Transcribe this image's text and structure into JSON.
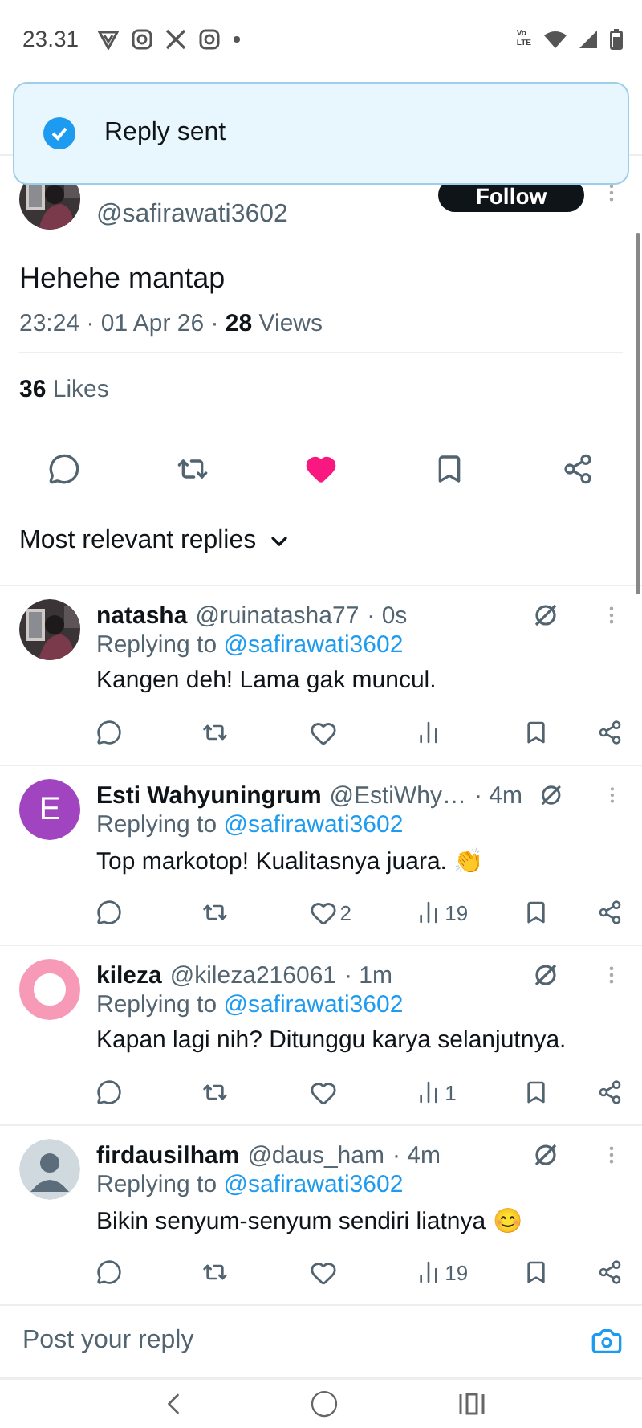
{
  "status_bar": {
    "time": "23.31",
    "network_label": [
      "Vo",
      "LTE"
    ]
  },
  "toast": {
    "message": "Reply sent"
  },
  "post": {
    "author_handle": "@safirawati3602",
    "follow_label": "Follow",
    "text": "Hehehe mantap",
    "time": "23:24 · 01 Apr 26 · ",
    "views_count": "28",
    "views_label": " Views",
    "likes_count": "36",
    "likes_label": " Likes",
    "liked": true,
    "bookmarked": false
  },
  "replies_sort": {
    "label": "Most relevant replies"
  },
  "replies": [
    {
      "name": "natasha",
      "handle": "@ruinatasha77",
      "time": "· 0s",
      "replying_label": "Replying to ",
      "replying_to": "@safirawati3602",
      "text": "Kangen deh! Lama gak muncul.",
      "liked": false
    },
    {
      "name": "Esti Wahyuningrum",
      "handle": "@EstiWhy…",
      "time": "· 4m",
      "replying_label": "Replying to ",
      "replying_to": "@safirawati3602",
      "text": "Top markotop! Kualitasnya juara. 👏",
      "likes": "2",
      "views": "19",
      "liked": false,
      "avatar": {
        "kind": "letter",
        "letter": "E",
        "color": "#a044c0"
      }
    },
    {
      "name": "kileza",
      "handle": "@kileza216061",
      "time": "· 1m",
      "replying_label": "Replying to ",
      "replying_to": "@safirawati3602",
      "text": "Kapan lagi nih? Ditunggu karya selanjutnya.",
      "views": "1",
      "liked": false,
      "avatar": {
        "kind": "ring",
        "color": "#f79ab8"
      }
    },
    {
      "name": "firdausilham",
      "handle": "@daus_ham",
      "time": "· 4m",
      "replying_label": "Replying to ",
      "replying_to": "@safirawati3602",
      "text": "Bikin senyum-senyum sendiri liatnya 😊",
      "views": "19",
      "liked": false,
      "avatar": {
        "kind": "default"
      }
    }
  ],
  "composer": {
    "placeholder": "Post your reply"
  }
}
